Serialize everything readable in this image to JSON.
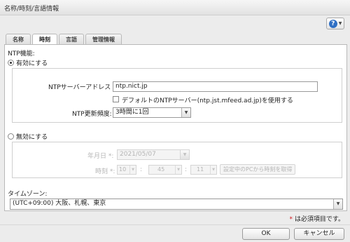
{
  "window": {
    "title": "名称/時刻/言語情報"
  },
  "help": {
    "glyph": "?",
    "caret": "▼"
  },
  "tabs": [
    {
      "label": "名称",
      "active": false
    },
    {
      "label": "時刻",
      "active": true
    },
    {
      "label": "言語",
      "active": false
    },
    {
      "label": "管理情報",
      "active": false
    }
  ],
  "ntp": {
    "section_label": "NTP機能:",
    "enable_label": "有効にする",
    "server_label": "NTPサーバーアドレス",
    "required_mark": "*",
    "colon": ":",
    "server_value": "ntp.nict.jp",
    "default_checkbox_label": "デフォルトのNTPサーバー(ntp.jst.mfeed.ad.jp)を使用する",
    "interval_label": "NTP更新頻度:",
    "interval_value": "3時間に1回",
    "disable_label": "無効にする"
  },
  "manual": {
    "date_label": "年月日",
    "date_value": "2021/05/07",
    "time_label": "時刻",
    "hour": "10",
    "minute": "45",
    "second": "11",
    "sync_button": "設定中のPCから時刻を取得"
  },
  "timezone": {
    "label": "タイムゾーン:",
    "value": "(UTC+09:00) 大阪、札幌、東京"
  },
  "footer": {
    "required_note_mark": "*",
    "required_note": "は必須項目です。",
    "ok": "OK",
    "cancel": "キャンセル"
  },
  "colors": {
    "required": "#d0141b",
    "help": "#2f6fc4"
  }
}
